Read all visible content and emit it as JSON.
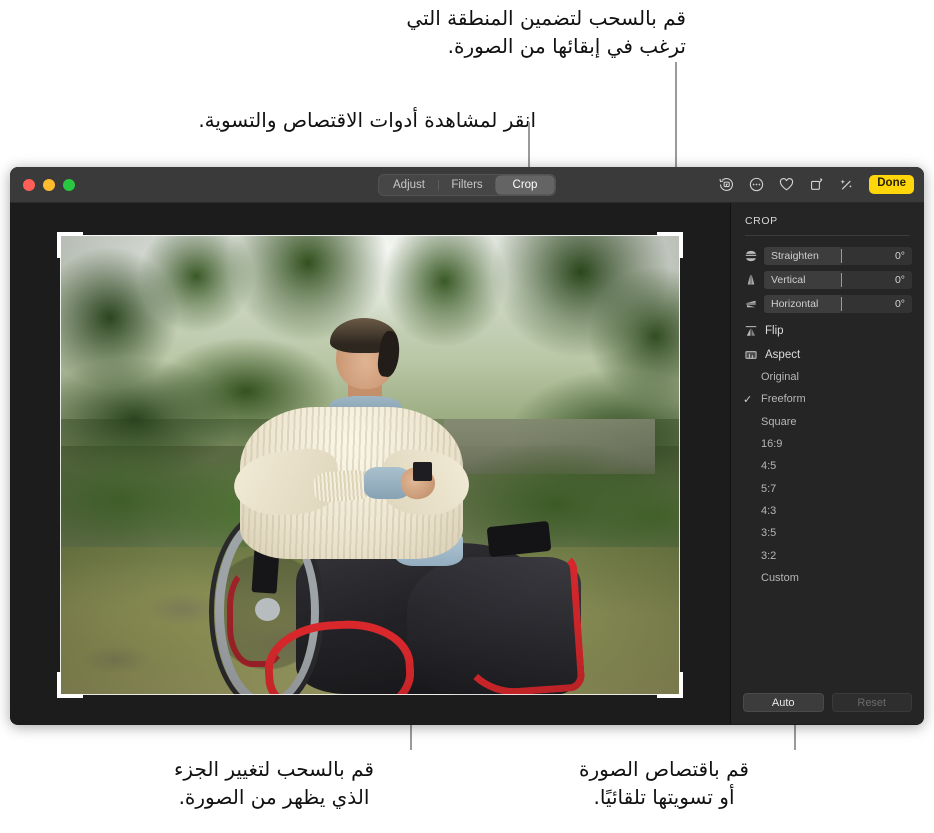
{
  "annotations": {
    "crop_area": "قم بالسحب لتضمين المنطقة التي\nترغب في إبقائها من الصورة.",
    "click_tools": "انقر لمشاهدة أدوات الاقتصاص والتسوية.",
    "drag_part": "قم بالسحب لتغيير الجزء\nالذي يظهر من الصورة.",
    "auto_crop": "قم باقتصاص الصورة\nأو تسويتها تلقائيًا."
  },
  "window": {
    "traffic_lights": [
      "close",
      "minimize",
      "zoom"
    ],
    "segmented": {
      "items": [
        {
          "label": "Adjust",
          "selected": false
        },
        {
          "label": "Filters",
          "selected": false
        },
        {
          "label": "Crop",
          "selected": true
        }
      ]
    },
    "toolbar_right": {
      "icons": [
        {
          "name": "revert-rotate-icon"
        },
        {
          "name": "more-ellipsis-icon"
        },
        {
          "name": "heart-icon"
        },
        {
          "name": "rotate-crop-icon"
        },
        {
          "name": "magic-wand-icon"
        }
      ],
      "done_label": "Done"
    }
  },
  "sidebar": {
    "title": "CROP",
    "sliders": [
      {
        "icon": "straighten-icon",
        "label": "Straighten",
        "value": "0°"
      },
      {
        "icon": "vertical-perspective-icon",
        "label": "Vertical",
        "value": "0°"
      },
      {
        "icon": "horizontal-perspective-icon",
        "label": "Horizontal",
        "value": "0°"
      }
    ],
    "menus": [
      {
        "icon": "flip-icon",
        "label": "Flip"
      },
      {
        "icon": "aspect-icon",
        "label": "Aspect"
      }
    ],
    "aspect_options": [
      {
        "label": "Original",
        "selected": false
      },
      {
        "label": "Freeform",
        "selected": true
      },
      {
        "label": "Square",
        "selected": false
      },
      {
        "label": "16:9",
        "selected": false
      },
      {
        "label": "4:5",
        "selected": false
      },
      {
        "label": "5:7",
        "selected": false
      },
      {
        "label": "4:3",
        "selected": false
      },
      {
        "label": "3:5",
        "selected": false
      },
      {
        "label": "3:2",
        "selected": false
      },
      {
        "label": "Custom",
        "selected": false
      }
    ],
    "check_glyph": "✓",
    "footer": {
      "auto_label": "Auto",
      "reset_label": "Reset"
    }
  },
  "colors": {
    "accent_done": "#ffd60a",
    "window_chrome": "#3a3a3a",
    "sidebar_bg": "#252525",
    "canvas_bg": "#1c1c1c",
    "traffic_close": "#ff5f57",
    "traffic_minimize": "#febc2e",
    "traffic_zoom": "#28c840"
  },
  "photo": {
    "description": "A smiling man in a red-framed wheelchair sitting on a mossy stone path in a lush green garden, looking upward."
  }
}
